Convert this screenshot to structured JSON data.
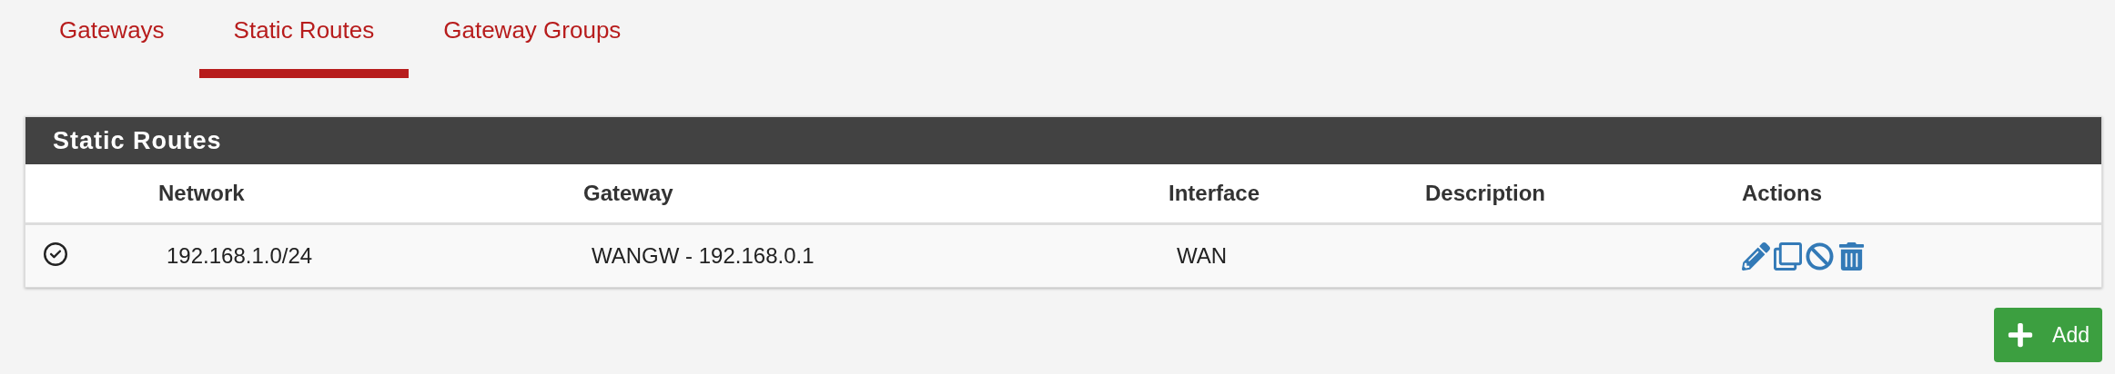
{
  "tabs": [
    {
      "label": "Gateways",
      "selected": false
    },
    {
      "label": "Static Routes",
      "selected": true
    },
    {
      "label": "Gateway Groups",
      "selected": false
    }
  ],
  "panel": {
    "title": "Static Routes",
    "columns": [
      "",
      "Network",
      "Gateway",
      "Interface",
      "Description",
      "Actions"
    ],
    "rows": [
      {
        "enabled": true,
        "network": "192.168.1.0/24",
        "gateway": "WANGW - 192.168.0.1",
        "interface": "WAN",
        "description": ""
      }
    ]
  },
  "add_button": {
    "label": "Add"
  }
}
